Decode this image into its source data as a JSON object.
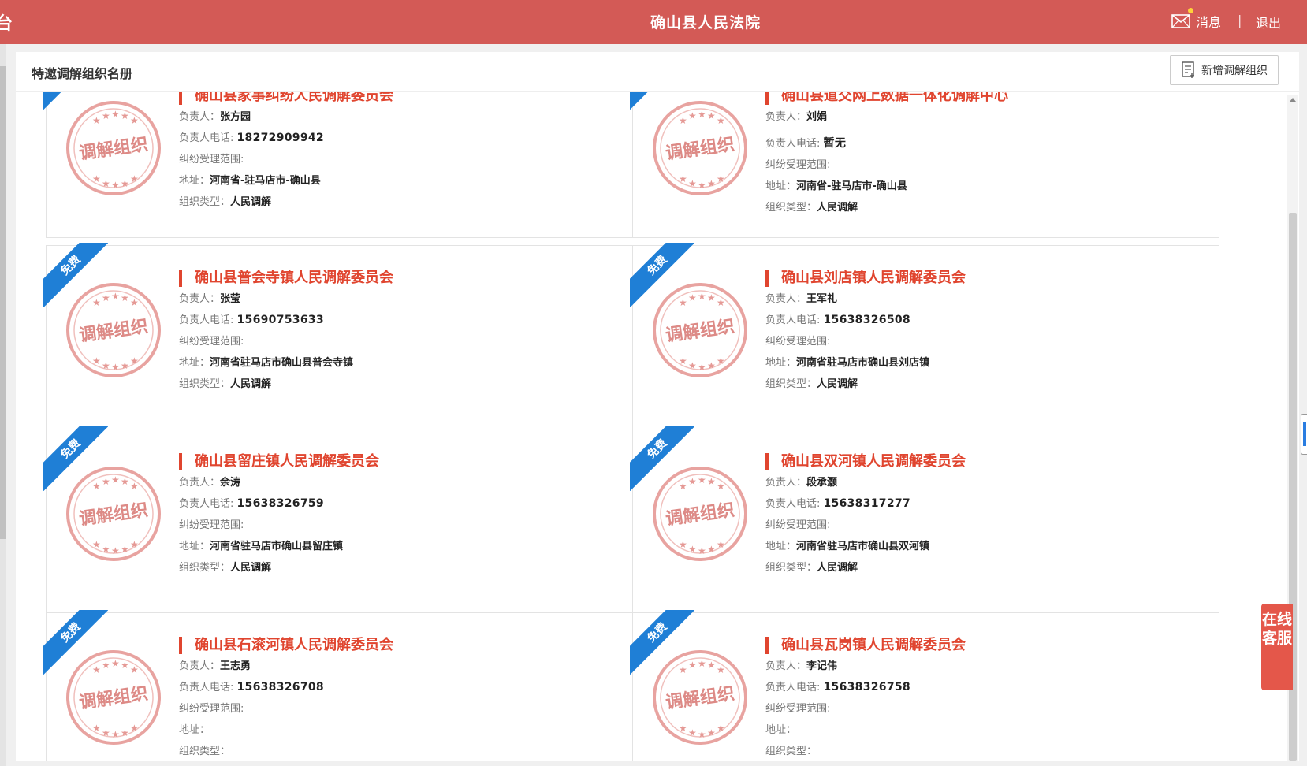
{
  "header": {
    "edge_char": "台",
    "title": "确山县人民法院",
    "messages_label": "消息",
    "separator": "|",
    "logout_label": "退出"
  },
  "panel": {
    "title": "特邀调解组织名册",
    "add_button_label": "新增调解组织"
  },
  "labels": {
    "head": "负责人：",
    "phone": "负责人电话: ",
    "scope": "纠纷受理范围:",
    "address": "地址：",
    "type": "组织类型：",
    "ribbon": "免费",
    "stamp": "调解组织"
  },
  "organizations": [
    {
      "name": "确山县家事纠纷人民调解委员会",
      "head": "张方园",
      "phone": "18272909942",
      "scope": "",
      "address": "河南省-驻马店市-确山县",
      "type": "人民调解"
    },
    {
      "name": "确山县道交网上数据一体化调解中心",
      "head": "刘娟",
      "phone": "暂无",
      "scope": "",
      "address": "河南省-驻马店市-确山县",
      "type": "人民调解"
    },
    {
      "name": "确山县普会寺镇人民调解委员会",
      "head": "张莹",
      "phone": "15690753633",
      "scope": "",
      "address": "河南省驻马店市确山县普会寺镇",
      "type": "人民调解"
    },
    {
      "name": "确山县刘店镇人民调解委员会",
      "head": "王军礼",
      "phone": "15638326508",
      "scope": "",
      "address": "河南省驻马店市确山县刘店镇",
      "type": "人民调解"
    },
    {
      "name": "确山县留庄镇人民调解委员会",
      "head": "余涛",
      "phone": "15638326759",
      "scope": "",
      "address": "河南省驻马店市确山县留庄镇",
      "type": "人民调解"
    },
    {
      "name": "确山县双河镇人民调解委员会",
      "head": "段承灏",
      "phone": "15638317277",
      "scope": "",
      "address": "河南省驻马店市确山县双河镇",
      "type": "人民调解"
    },
    {
      "name": "确山县石滚河镇人民调解委员会",
      "head": "王志勇",
      "phone": "15638326708",
      "scope": "",
      "address": "",
      "type": ""
    },
    {
      "name": "确山县瓦岗镇人民调解委员会",
      "head": "李记伟",
      "phone": "15638326758",
      "scope": "",
      "address": "",
      "type": ""
    }
  ],
  "float_service_label": "在线客服",
  "colors": {
    "header_bg": "#d35a56",
    "org_title": "#e0452f",
    "ribbon": "#1f7fd6",
    "stamp": "#d9534f"
  }
}
